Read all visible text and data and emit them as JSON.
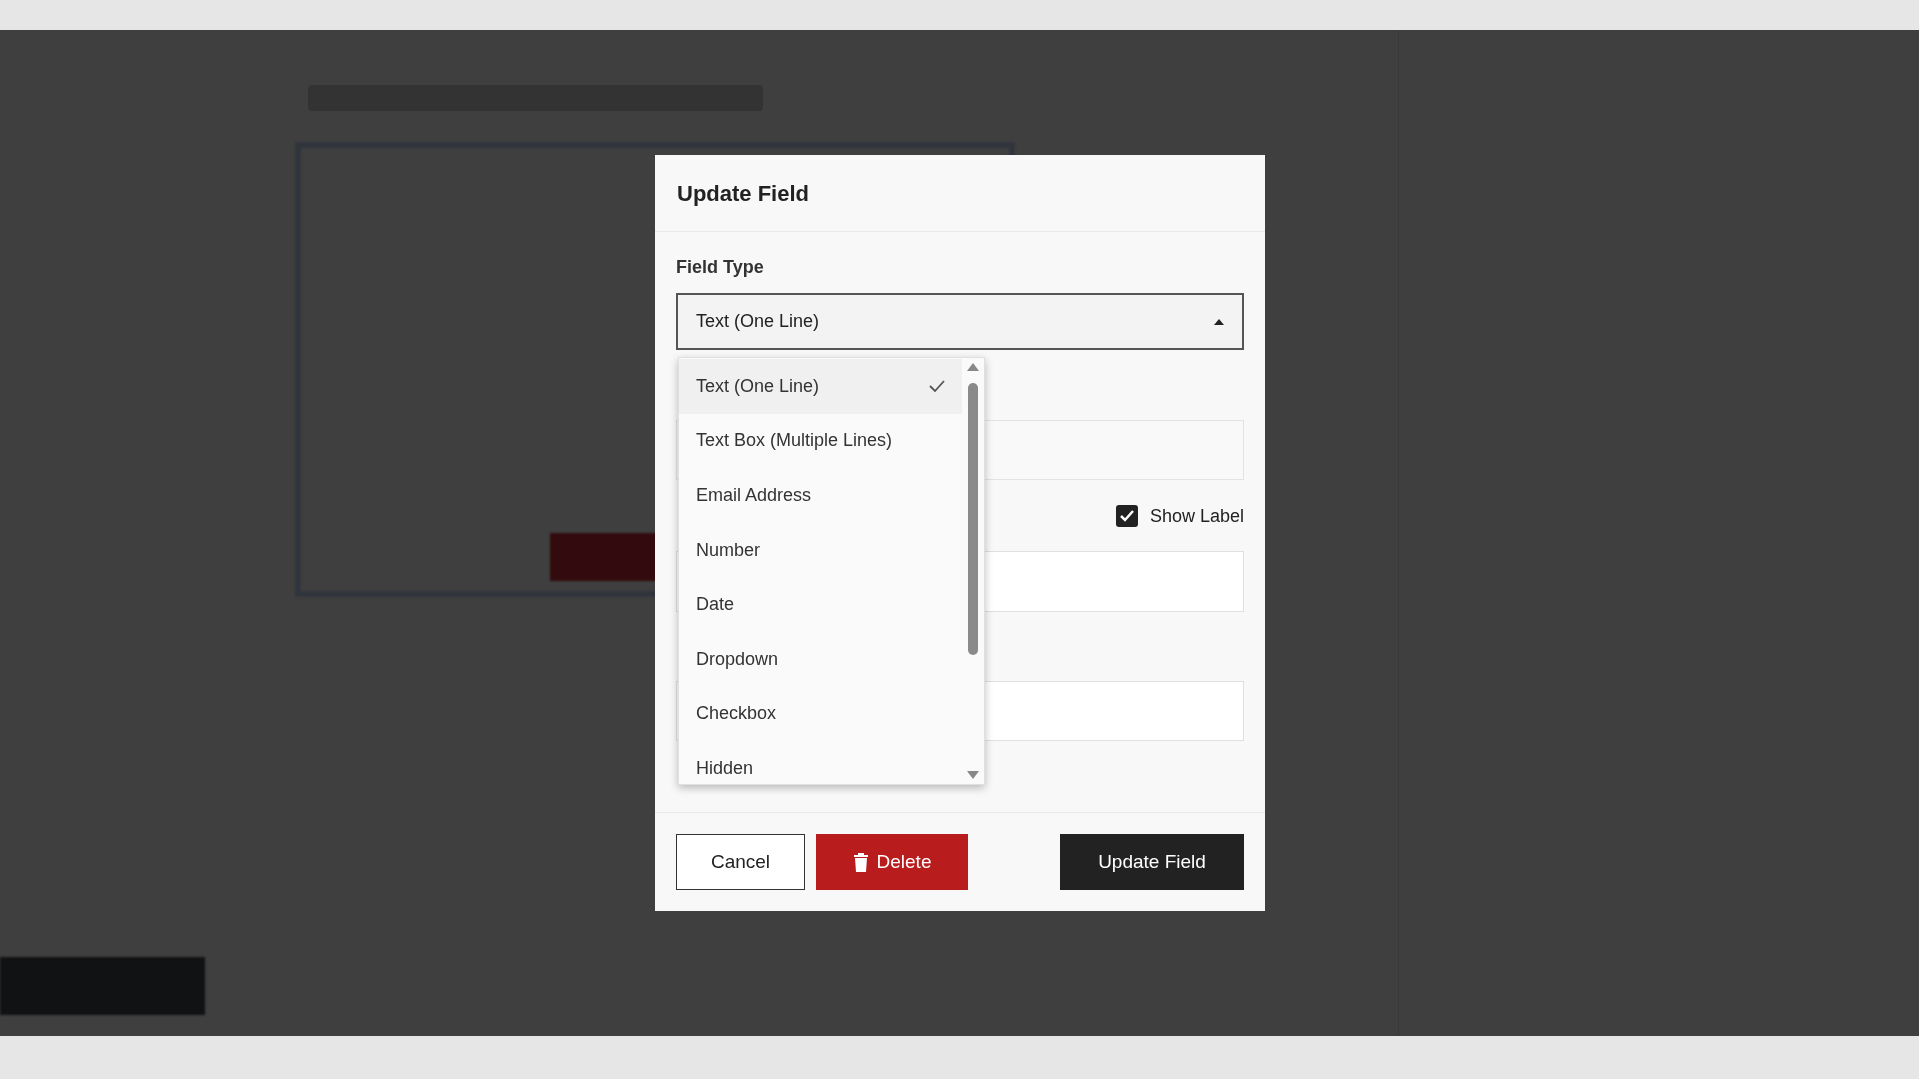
{
  "dialog": {
    "title": "Update Field",
    "field_type": {
      "label": "Field Type",
      "value": "Text (One Line)",
      "expanded": true
    },
    "options": [
      {
        "label": "Text (One Line)",
        "selected": true
      },
      {
        "label": "Text Box (Multiple Lines)",
        "selected": false
      },
      {
        "label": "Email Address",
        "selected": false
      },
      {
        "label": "Number",
        "selected": false
      },
      {
        "label": "Date",
        "selected": false
      },
      {
        "label": "Dropdown",
        "selected": false
      },
      {
        "label": "Checkbox",
        "selected": false
      },
      {
        "label": "Hidden",
        "selected": false
      }
    ],
    "show_label": {
      "label": "Show Label",
      "checked": true
    },
    "buttons": [
      {
        "label": "Cancel",
        "kind": "secondary"
      },
      {
        "label": "Delete",
        "kind": "danger"
      },
      {
        "label": "Update Field",
        "kind": "primary"
      }
    ]
  }
}
